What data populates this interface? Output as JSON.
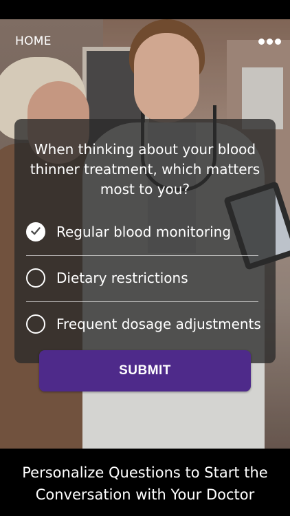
{
  "nav": {
    "home_label": "HOME",
    "more_icon": "more-dots-icon"
  },
  "question": "When thinking about your blood thinner treatment, which matters most to you?",
  "options": [
    {
      "label": "Regular blood monitoring",
      "selected": true
    },
    {
      "label": "Dietary restrictions",
      "selected": false
    },
    {
      "label": "Frequent dosage adjustments",
      "selected": false
    }
  ],
  "submit_label": "SUBMIT",
  "caption_line1": "Personalize Questions to Start the",
  "caption_line2": "Conversation with Your Doctor",
  "colors": {
    "submit_bg": "#4e2a8a",
    "card_bg": "rgba(42,42,42,0.78)",
    "text": "#ffffff"
  }
}
